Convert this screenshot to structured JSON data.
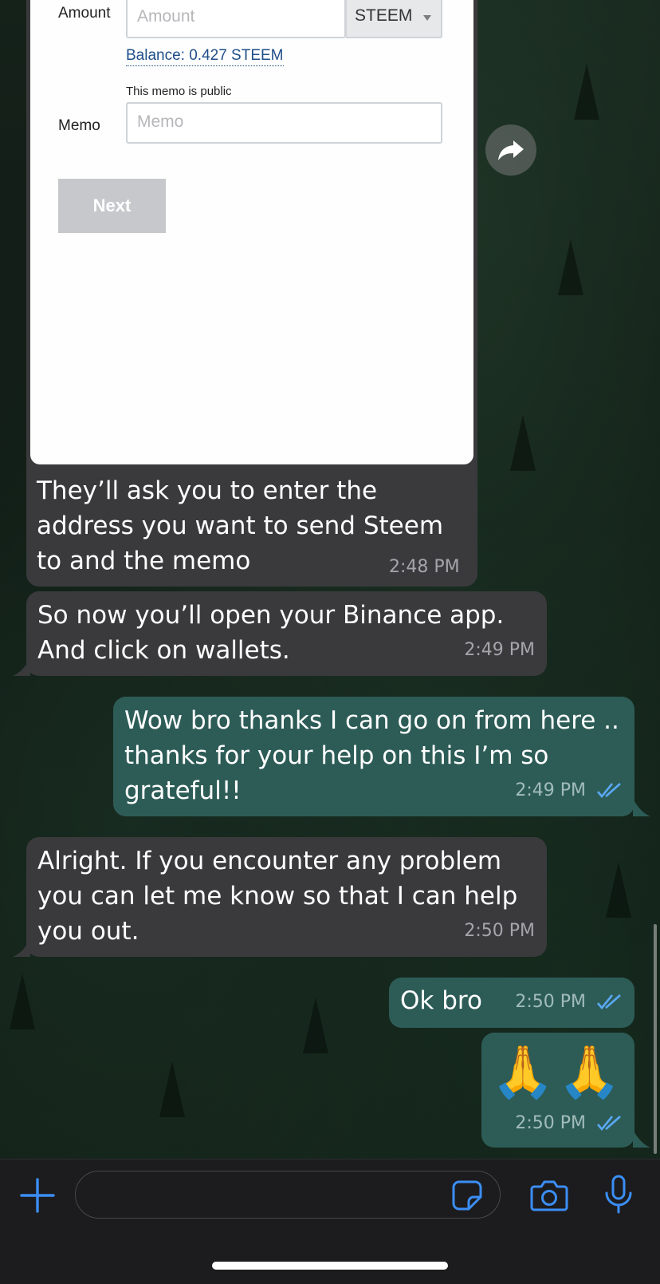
{
  "form": {
    "amount_label": "Amount",
    "amount_placeholder": "Amount",
    "currency": "STEEM",
    "balance": "Balance: 0.427 STEEM",
    "memo_note": "This memo is public",
    "memo_label": "Memo",
    "memo_placeholder": "Memo",
    "next_label": "Next"
  },
  "messages": [
    {
      "direction": "in",
      "text": "They’ll ask you to enter the address you want to send Steem to and the memo",
      "time": "2:48 PM"
    },
    {
      "direction": "in",
      "text": "So now you’ll open your Binance app. And click on wallets.",
      "time": "2:49 PM"
    },
    {
      "direction": "out",
      "text": "Wow bro thanks I can go on from here .. thanks for your help on this I’m so grateful!!",
      "time": "2:49 PM",
      "read": true
    },
    {
      "direction": "in",
      "text": "Alright. If you encounter any problem you can let me know so that I can help you out.",
      "time": "2:50 PM"
    },
    {
      "direction": "out",
      "text": "Ok bro",
      "time": "2:50 PM",
      "read": true
    },
    {
      "direction": "out",
      "text": "🙏🙏",
      "time": "2:50 PM",
      "read": true
    }
  ],
  "composer": {
    "message_placeholder": "",
    "icons": [
      "plus-icon",
      "sticker-icon",
      "camera-icon",
      "microphone-icon"
    ]
  },
  "colors": {
    "incoming_bubble": "#3a3a3c",
    "outgoing_bubble": "#2d5c57",
    "accent": "#3b8ef5",
    "read_ticks": "#5aa9f5"
  }
}
